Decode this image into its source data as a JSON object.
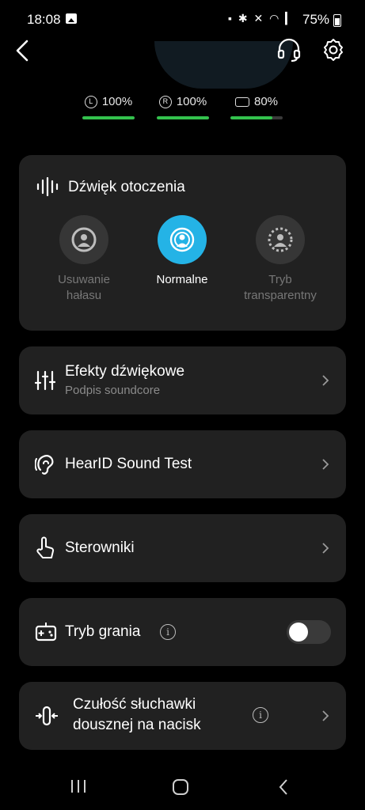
{
  "status_bar": {
    "time": "18:08",
    "battery": "75%"
  },
  "batteries": [
    {
      "icon": "L",
      "label": "100%",
      "level": 1.0
    },
    {
      "icon": "R",
      "label": "100%",
      "level": 1.0
    },
    {
      "icon": "case",
      "label": "80%",
      "level": 0.8
    }
  ],
  "ambient": {
    "title": "Dźwięk otoczenia",
    "modes": [
      {
        "label_line1": "Usuwanie",
        "label_line2": "hałasu",
        "active": false
      },
      {
        "label_line1": "Normalne",
        "label_line2": "",
        "active": true
      },
      {
        "label_line1": "Tryb",
        "label_line2": "transparentny",
        "active": false
      }
    ]
  },
  "menu": {
    "effects": {
      "title": "Efekty dźwiękowe",
      "subtitle": "Podpis soundcore"
    },
    "hearid": {
      "title": "HearID Sound Test"
    },
    "controls": {
      "title": "Sterowniki"
    },
    "gaming": {
      "title": "Tryb grania",
      "enabled": false
    },
    "sensitivity": {
      "title_line1": "Czułość słuchawki",
      "title_line2": "dousznej na nacisk"
    }
  },
  "colors": {
    "accent": "#24b3e6",
    "battery_green": "#33c24d",
    "card": "#212121"
  }
}
